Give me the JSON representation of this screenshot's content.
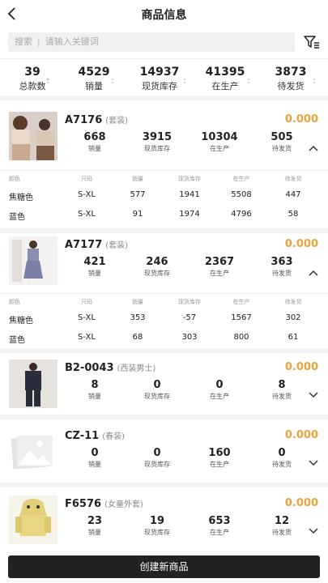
{
  "header": {
    "title": "商品信息"
  },
  "search": {
    "label": "搜索",
    "placeholder": "请输入关键词"
  },
  "summary": [
    {
      "value": "39",
      "label": "总款数"
    },
    {
      "value": "4529",
      "label": "销量"
    },
    {
      "value": "14937",
      "label": "现货库存"
    },
    {
      "value": "41395",
      "label": "在生产"
    },
    {
      "value": "3873",
      "label": "待发货"
    }
  ],
  "stat_labels": [
    "销量",
    "现货库存",
    "在生产",
    "待发货"
  ],
  "variant_headers": [
    "颜色",
    "尺码",
    "销量",
    "现货库存",
    "在生产",
    "待发货"
  ],
  "products": [
    {
      "code": "A7176",
      "category": "(套装)",
      "price": "0.000",
      "stats": [
        "668",
        "3915",
        "10304",
        "505"
      ],
      "expanded": true,
      "variants": [
        [
          "焦糖色",
          "S-XL",
          "577",
          "1941",
          "5508",
          "447"
        ],
        [
          "蓝色",
          "S-XL",
          "91",
          "1974",
          "4796",
          "58"
        ]
      ]
    },
    {
      "code": "A7177",
      "category": "(套装)",
      "price": "0.000",
      "stats": [
        "421",
        "246",
        "2367",
        "363"
      ],
      "expanded": true,
      "variants": [
        [
          "焦糖色",
          "S-XL",
          "353",
          "-57",
          "1567",
          "302"
        ],
        [
          "蓝色",
          "S-XL",
          "68",
          "303",
          "800",
          "61"
        ]
      ]
    },
    {
      "code": "B2-0043",
      "category": "(西装男士)",
      "price": "0.000",
      "stats": [
        "8",
        "0",
        "0",
        "8"
      ],
      "expanded": false
    },
    {
      "code": "CZ-11",
      "category": "(春装)",
      "price": "0.000",
      "stats": [
        "0",
        "0",
        "160",
        "0"
      ],
      "expanded": false
    },
    {
      "code": "F6576",
      "category": "(女童外套)",
      "price": "0.000",
      "stats": [
        "23",
        "19",
        "653",
        "12"
      ],
      "expanded": false
    }
  ],
  "create_button": "创建新商品"
}
